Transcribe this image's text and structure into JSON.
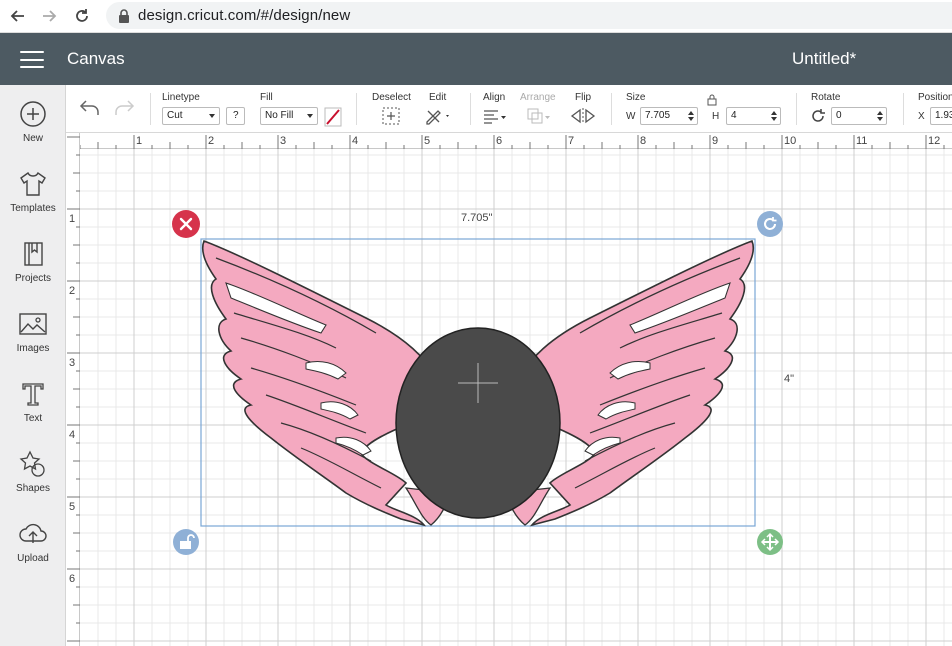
{
  "browser": {
    "url": "design.cricut.com/#/design/new"
  },
  "appbar": {
    "title": "Canvas",
    "document_title": "Untitled*"
  },
  "sidebar": {
    "items": [
      {
        "label": "New",
        "icon": "plus-circle-icon"
      },
      {
        "label": "Templates",
        "icon": "tshirt-icon"
      },
      {
        "label": "Projects",
        "icon": "notebook-icon"
      },
      {
        "label": "Images",
        "icon": "image-icon"
      },
      {
        "label": "Text",
        "icon": "text-t-icon"
      },
      {
        "label": "Shapes",
        "icon": "shapes-icon"
      },
      {
        "label": "Upload",
        "icon": "cloud-upload-icon"
      }
    ]
  },
  "toolbar": {
    "linetype": {
      "label": "Linetype",
      "value": "Cut",
      "help": "?"
    },
    "fill": {
      "label": "Fill",
      "value": "No Fill"
    },
    "deselect": {
      "label": "Deselect"
    },
    "edit": {
      "label": "Edit"
    },
    "align": {
      "label": "Align"
    },
    "arrange": {
      "label": "Arrange"
    },
    "flip": {
      "label": "Flip"
    },
    "size": {
      "label": "Size",
      "w_label": "W",
      "w_value": "7.705",
      "h_label": "H",
      "h_value": "4"
    },
    "rotate": {
      "label": "Rotate",
      "value": "0"
    },
    "position": {
      "label": "Position",
      "x_label": "X",
      "x_value": "1.93"
    }
  },
  "canvas": {
    "ruler_top": [
      "1",
      "2",
      "3",
      "4",
      "5",
      "6",
      "7",
      "8",
      "9",
      "10",
      "11",
      "12"
    ],
    "ruler_left": [
      "1",
      "2",
      "3",
      "4",
      "5",
      "6"
    ],
    "width_label": "7.705\"",
    "height_label": "4\""
  },
  "colors": {
    "appbar": "#4d5a62",
    "wing_fill": "#f4a9c0",
    "oval_fill": "#4a4a4a",
    "delete_handle": "#d6334b",
    "rotate_handle": "#8fb0d6",
    "lock_handle": "#8fb0d6",
    "resize_handle": "#7dbf86",
    "selection_box": "#7aa7d6"
  }
}
